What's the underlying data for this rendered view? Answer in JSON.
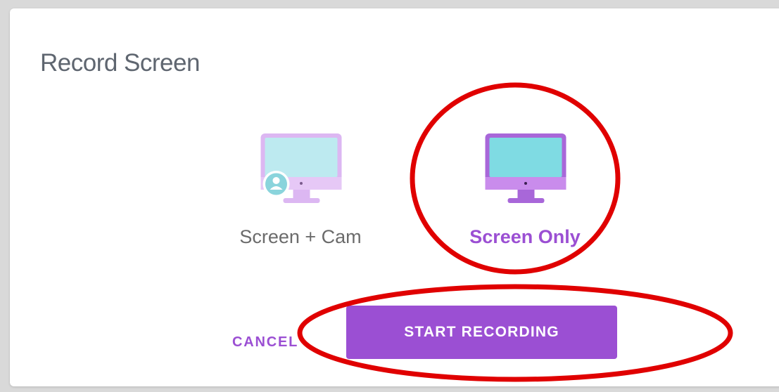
{
  "dialog": {
    "title": "Record Screen"
  },
  "options": [
    {
      "label": "Screen + Cam",
      "icon": "monitor-with-user-icon",
      "selected": false
    },
    {
      "label": "Screen Only",
      "icon": "monitor-icon",
      "selected": true
    }
  ],
  "actions": {
    "cancel_label": "CANCEL",
    "start_label": "START RECORDING"
  },
  "colors": {
    "accent": "#9b4fd3",
    "annotation": "#e00000",
    "screen_inactive": "#bdeaf0",
    "screen_active": "#7fdbe3",
    "frame_inactive": "#dcb7f2",
    "frame_active": "#a867d9"
  }
}
